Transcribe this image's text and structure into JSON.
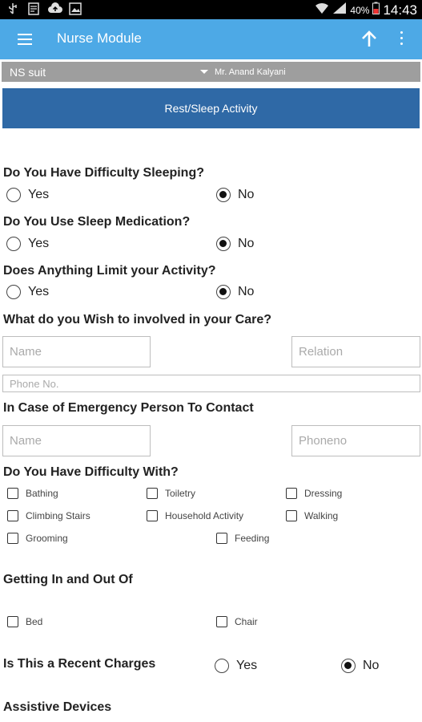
{
  "status_bar": {
    "battery": "40%",
    "time": "14:43"
  },
  "app_bar": {
    "title": "Nurse Module"
  },
  "selector": {
    "suit": "NS suit",
    "patient": "Mr. Anand Kalyani"
  },
  "section_title": "Rest/Sleep Activity",
  "questions": [
    {
      "label": "Do You Have Difficulty Sleeping?",
      "yes": "Yes",
      "no": "No",
      "selected": "No"
    },
    {
      "label": "Do You Use Sleep Medication?",
      "yes": "Yes",
      "no": "No",
      "selected": "No"
    },
    {
      "label": "Does Anything Limit your Activity?",
      "yes": "Yes",
      "no": "No",
      "selected": "No"
    }
  ],
  "care_involvement": {
    "label": "What do you Wish to involved in your Care?",
    "name_placeholder": "Name",
    "relation_placeholder": "Relation",
    "phone_placeholder": "Phone No."
  },
  "emergency_contact": {
    "label": "In Case of Emergency Person To Contact",
    "name_placeholder": "Name",
    "phone_placeholder": "Phoneno"
  },
  "difficulty_with": {
    "label": "Do You Have Difficulty With?",
    "options": [
      "Bathing",
      "Toiletry",
      "Dressing",
      "Climbing Stairs",
      "Household Activity",
      "Walking",
      "Grooming",
      "Feeding"
    ]
  },
  "getting_in_out": {
    "label": "Getting In and Out Of",
    "options": [
      "Bed",
      "Chair"
    ]
  },
  "recent_changes": {
    "label": "Is This a Recent Charges",
    "yes": "Yes",
    "no": "No",
    "selected": "No"
  },
  "assistive_devices": {
    "label": "Assistive Devices"
  },
  "icons": {
    "menu": "hamburger-menu-icon",
    "up": "arrow-up-icon",
    "more": "overflow-menu-icon",
    "dropdown": "dropdown-arrow-icon"
  },
  "colors": {
    "app_bar": "#4da9e6",
    "section_header": "#2f69a6",
    "selector_bar": "#9e9e9e"
  }
}
